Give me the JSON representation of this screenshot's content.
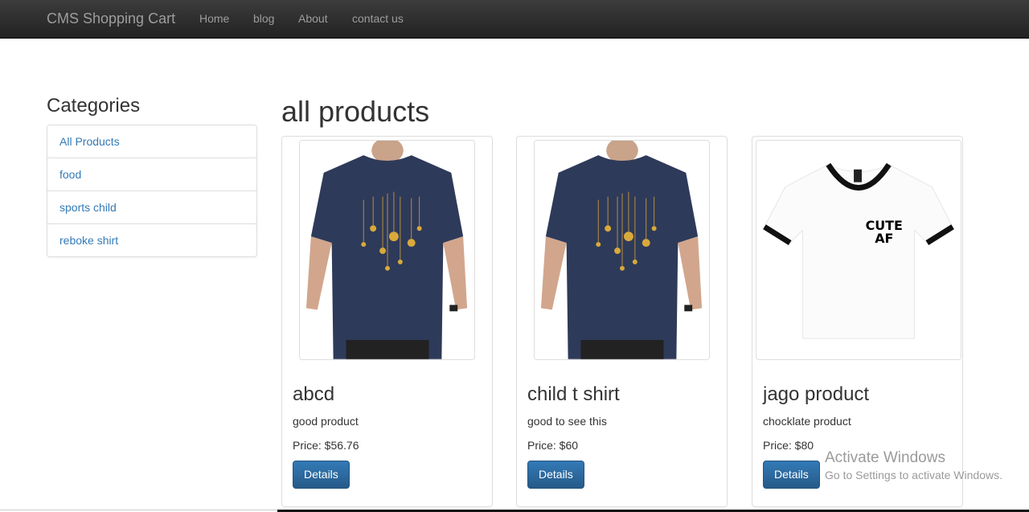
{
  "navbar": {
    "brand": "CMS Shopping Cart",
    "links": [
      "Home",
      "blog",
      "About",
      "contact us"
    ]
  },
  "sidebar": {
    "title": "Categories",
    "items": [
      {
        "label": "All Products"
      },
      {
        "label": "food"
      },
      {
        "label": "sports child"
      },
      {
        "label": "reboke shirt"
      }
    ]
  },
  "main": {
    "title": "all products",
    "products": [
      {
        "name": "abcd",
        "description": "good product",
        "price": "Price: $56.76",
        "button": "Details",
        "image": "navy-tshirt-lights"
      },
      {
        "name": "child t shirt",
        "description": "good to see this",
        "price": "Price: $60",
        "button": "Details",
        "image": "navy-tshirt-lights"
      },
      {
        "name": "jago product",
        "description": "chocklate product",
        "price": "Price: $80",
        "button": "Details",
        "image": "white-ringer-tshirt"
      }
    ]
  },
  "watermark": {
    "line1": "Activate Windows",
    "line2": "Go to Settings to activate Windows."
  },
  "colors": {
    "navbar_bg": "#222222",
    "link": "#337ab7",
    "button": "#265a88"
  }
}
